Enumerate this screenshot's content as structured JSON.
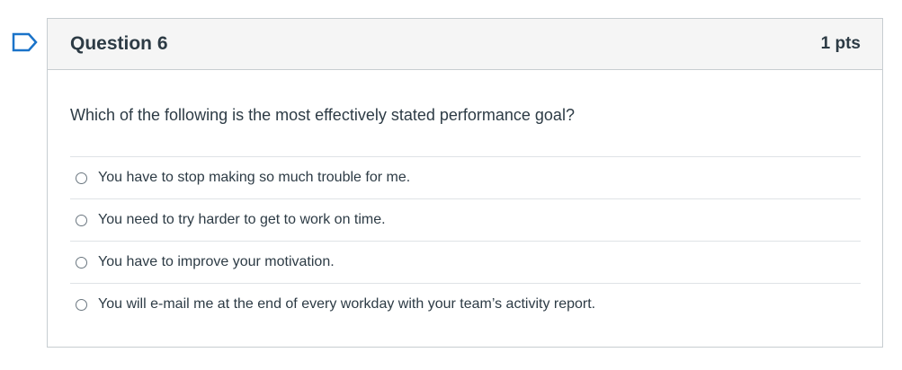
{
  "question": {
    "title": "Question 6",
    "points": "1 pts",
    "text": "Which of the following is the most effectively stated performance goal?",
    "flag_icon": "flag-icon",
    "selected_answer": null,
    "answers": [
      {
        "label": "You have to stop making so much trouble for me."
      },
      {
        "label": "You need to try harder to get to work on time."
      },
      {
        "label": "You have to improve your motivation."
      },
      {
        "label": "You will e-mail me at the end of every workday with your team’s activity report."
      }
    ]
  },
  "colors": {
    "flag": "#1a73c9",
    "header_bg": "#f5f5f5",
    "border": "#c7cdd1",
    "text": "#2d3b45"
  }
}
